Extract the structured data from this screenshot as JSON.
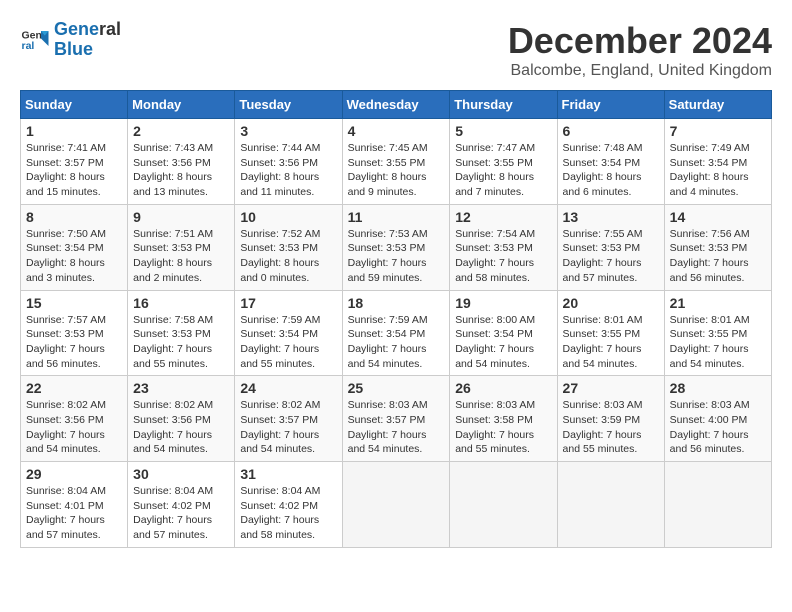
{
  "logo": {
    "line1": "General",
    "line2": "Blue"
  },
  "title": "December 2024",
  "subtitle": "Balcombe, England, United Kingdom",
  "days_of_week": [
    "Sunday",
    "Monday",
    "Tuesday",
    "Wednesday",
    "Thursday",
    "Friday",
    "Saturday"
  ],
  "weeks": [
    [
      {
        "day": "1",
        "detail": "Sunrise: 7:41 AM\nSunset: 3:57 PM\nDaylight: 8 hours and 15 minutes."
      },
      {
        "day": "2",
        "detail": "Sunrise: 7:43 AM\nSunset: 3:56 PM\nDaylight: 8 hours and 13 minutes."
      },
      {
        "day": "3",
        "detail": "Sunrise: 7:44 AM\nSunset: 3:56 PM\nDaylight: 8 hours and 11 minutes."
      },
      {
        "day": "4",
        "detail": "Sunrise: 7:45 AM\nSunset: 3:55 PM\nDaylight: 8 hours and 9 minutes."
      },
      {
        "day": "5",
        "detail": "Sunrise: 7:47 AM\nSunset: 3:55 PM\nDaylight: 8 hours and 7 minutes."
      },
      {
        "day": "6",
        "detail": "Sunrise: 7:48 AM\nSunset: 3:54 PM\nDaylight: 8 hours and 6 minutes."
      },
      {
        "day": "7",
        "detail": "Sunrise: 7:49 AM\nSunset: 3:54 PM\nDaylight: 8 hours and 4 minutes."
      }
    ],
    [
      {
        "day": "8",
        "detail": "Sunrise: 7:50 AM\nSunset: 3:54 PM\nDaylight: 8 hours and 3 minutes."
      },
      {
        "day": "9",
        "detail": "Sunrise: 7:51 AM\nSunset: 3:53 PM\nDaylight: 8 hours and 2 minutes."
      },
      {
        "day": "10",
        "detail": "Sunrise: 7:52 AM\nSunset: 3:53 PM\nDaylight: 8 hours and 0 minutes."
      },
      {
        "day": "11",
        "detail": "Sunrise: 7:53 AM\nSunset: 3:53 PM\nDaylight: 7 hours and 59 minutes."
      },
      {
        "day": "12",
        "detail": "Sunrise: 7:54 AM\nSunset: 3:53 PM\nDaylight: 7 hours and 58 minutes."
      },
      {
        "day": "13",
        "detail": "Sunrise: 7:55 AM\nSunset: 3:53 PM\nDaylight: 7 hours and 57 minutes."
      },
      {
        "day": "14",
        "detail": "Sunrise: 7:56 AM\nSunset: 3:53 PM\nDaylight: 7 hours and 56 minutes."
      }
    ],
    [
      {
        "day": "15",
        "detail": "Sunrise: 7:57 AM\nSunset: 3:53 PM\nDaylight: 7 hours and 56 minutes."
      },
      {
        "day": "16",
        "detail": "Sunrise: 7:58 AM\nSunset: 3:53 PM\nDaylight: 7 hours and 55 minutes."
      },
      {
        "day": "17",
        "detail": "Sunrise: 7:59 AM\nSunset: 3:54 PM\nDaylight: 7 hours and 55 minutes."
      },
      {
        "day": "18",
        "detail": "Sunrise: 7:59 AM\nSunset: 3:54 PM\nDaylight: 7 hours and 54 minutes."
      },
      {
        "day": "19",
        "detail": "Sunrise: 8:00 AM\nSunset: 3:54 PM\nDaylight: 7 hours and 54 minutes."
      },
      {
        "day": "20",
        "detail": "Sunrise: 8:01 AM\nSunset: 3:55 PM\nDaylight: 7 hours and 54 minutes."
      },
      {
        "day": "21",
        "detail": "Sunrise: 8:01 AM\nSunset: 3:55 PM\nDaylight: 7 hours and 54 minutes."
      }
    ],
    [
      {
        "day": "22",
        "detail": "Sunrise: 8:02 AM\nSunset: 3:56 PM\nDaylight: 7 hours and 54 minutes."
      },
      {
        "day": "23",
        "detail": "Sunrise: 8:02 AM\nSunset: 3:56 PM\nDaylight: 7 hours and 54 minutes."
      },
      {
        "day": "24",
        "detail": "Sunrise: 8:02 AM\nSunset: 3:57 PM\nDaylight: 7 hours and 54 minutes."
      },
      {
        "day": "25",
        "detail": "Sunrise: 8:03 AM\nSunset: 3:57 PM\nDaylight: 7 hours and 54 minutes."
      },
      {
        "day": "26",
        "detail": "Sunrise: 8:03 AM\nSunset: 3:58 PM\nDaylight: 7 hours and 55 minutes."
      },
      {
        "day": "27",
        "detail": "Sunrise: 8:03 AM\nSunset: 3:59 PM\nDaylight: 7 hours and 55 minutes."
      },
      {
        "day": "28",
        "detail": "Sunrise: 8:03 AM\nSunset: 4:00 PM\nDaylight: 7 hours and 56 minutes."
      }
    ],
    [
      {
        "day": "29",
        "detail": "Sunrise: 8:04 AM\nSunset: 4:01 PM\nDaylight: 7 hours and 57 minutes."
      },
      {
        "day": "30",
        "detail": "Sunrise: 8:04 AM\nSunset: 4:02 PM\nDaylight: 7 hours and 57 minutes."
      },
      {
        "day": "31",
        "detail": "Sunrise: 8:04 AM\nSunset: 4:02 PM\nDaylight: 7 hours and 58 minutes."
      },
      null,
      null,
      null,
      null
    ]
  ]
}
